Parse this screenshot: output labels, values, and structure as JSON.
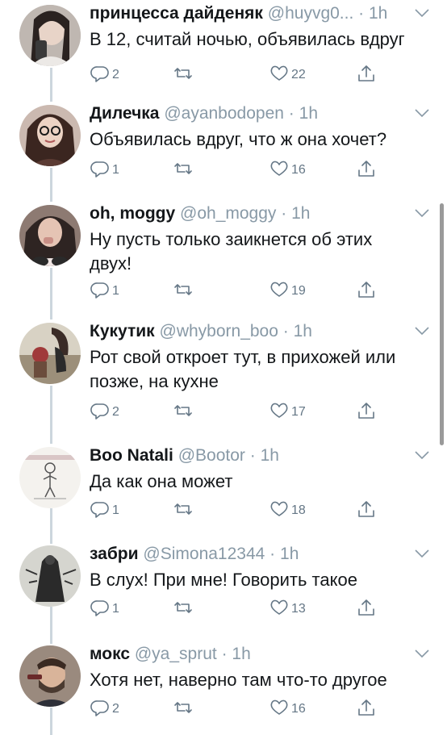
{
  "tweets": [
    {
      "name": "принцесса дайденяк",
      "handle": "@huyvg0...",
      "dot": "·",
      "time": "1h",
      "text": "В 12, считай ночью, объявилась вдруг",
      "replies": "2",
      "retweets": "",
      "likes": "22"
    },
    {
      "name": "Дилечка",
      "handle": "@ayanbodopen",
      "dot": "·",
      "time": "1h",
      "text": "Объявилась вдруг, что ж она хочет?",
      "replies": "1",
      "retweets": "",
      "likes": "16"
    },
    {
      "name": "oh, moggy",
      "handle": "@oh_moggy",
      "dot": "·",
      "time": "1h",
      "text": "Ну пусть только заикнется об этих двух!",
      "replies": "1",
      "retweets": "",
      "likes": "19"
    },
    {
      "name": "Кукутик",
      "handle": "@whyborn_boo",
      "dot": "·",
      "time": "1h",
      "text": "Рот свой откроет тут, в прихожей или позже, на кухне",
      "replies": "2",
      "retweets": "",
      "likes": "17"
    },
    {
      "name": "Boo Natali",
      "handle": "@Bootor",
      "dot": "·",
      "time": "1h",
      "text": "Да как она может",
      "replies": "1",
      "retweets": "",
      "likes": "18"
    },
    {
      "name": "забри",
      "handle": "@Simona12344",
      "dot": "·",
      "time": "1h",
      "text": "В слух! При мне! Говорить такое",
      "replies": "1",
      "retweets": "",
      "likes": "13"
    },
    {
      "name": "мокс",
      "handle": "@ya_sprut",
      "dot": "·",
      "time": "1h",
      "text": "Хотя нет, наверно там что-то другое",
      "replies": "2",
      "retweets": "",
      "likes": "16"
    }
  ],
  "colors": {
    "text": "#14171a",
    "secondary": "#8899a6",
    "icon": "#657786",
    "thread_line": "#ccd6dd"
  }
}
